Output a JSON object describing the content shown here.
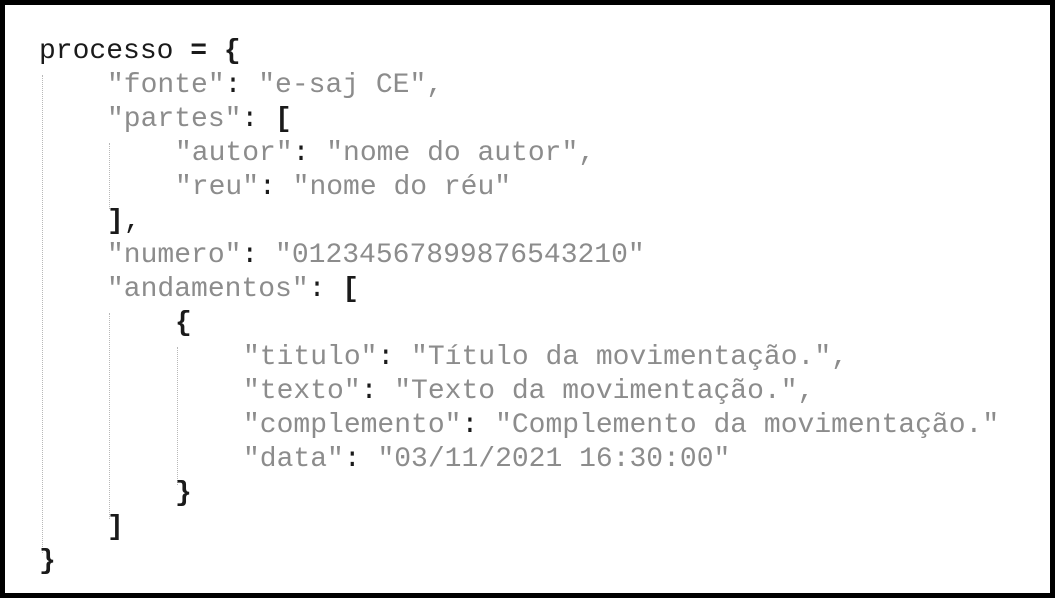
{
  "code": {
    "var_name": "processo",
    "assign_open": "= {",
    "fonte_key": "\"fonte\"",
    "fonte_colon": ":",
    "fonte_value": "\"e-saj CE\",",
    "partes_key": "\"partes\"",
    "partes_colon": ":",
    "partes_open": "[",
    "autor_key": "\"autor\"",
    "autor_colon": ":",
    "autor_value": "\"nome do autor\",",
    "reu_key": "\"reu\"",
    "reu_colon": ":",
    "reu_value": "\"nome do réu\"",
    "partes_close_bracket": "]",
    "partes_close_comma": ",",
    "numero_key": "\"numero\"",
    "numero_colon": ":",
    "numero_value": "\"01234567899876543210\"",
    "andamentos_key": "\"andamentos\"",
    "andamentos_colon": ":",
    "andamentos_open": "[",
    "item_open": "{",
    "titulo_key": "\"titulo\"",
    "titulo_colon": ":",
    "titulo_value": "\"Título da movimentação.\",",
    "texto_key": "\"texto\"",
    "texto_colon": ":",
    "texto_value": "\"Texto da movimentação.\",",
    "complemento_key": "\"complemento\"",
    "complemento_colon": ":",
    "complemento_value": "\"Complemento da movimentação.\"",
    "data_key": "\"data\"",
    "data_colon": ":",
    "data_value": "\"03/11/2021 16:30:00\"",
    "item_close": "}",
    "andamentos_close": "]",
    "root_close": "}"
  }
}
